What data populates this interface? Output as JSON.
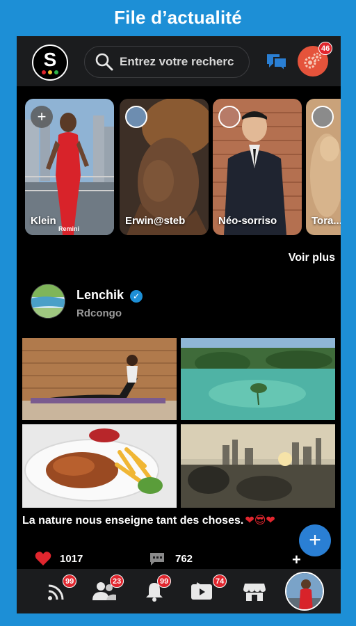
{
  "banner": {
    "title": "File d’actualité"
  },
  "header": {
    "logo_letter": "S",
    "search_placeholder": "Entrez votre recherc",
    "notification_count": "46"
  },
  "stories": [
    {
      "name": "Klein",
      "tag": "Remini",
      "type": "add"
    },
    {
      "name": "Erwin@steb",
      "type": "story"
    },
    {
      "name": "Néo-sorriso",
      "type": "story"
    },
    {
      "name": "Tora...",
      "type": "story"
    }
  ],
  "see_more": "Voir plus",
  "post": {
    "author": "Lenchik",
    "location": "Rdcongo",
    "caption": "La nature nous enseigne tant des choses.",
    "caption_emojis": "❤😎❤",
    "likes": "1017",
    "comments": "762",
    "share_symbol": "+"
  },
  "nav": {
    "feed_badge": "99",
    "friends_badge": "23",
    "notifications_badge": "99",
    "videos_badge": "74"
  },
  "colors": {
    "banner_bg": "#1d8fd6",
    "accent": "#2a7fd4",
    "badge": "#e0262e",
    "heart": "#e0262e"
  }
}
